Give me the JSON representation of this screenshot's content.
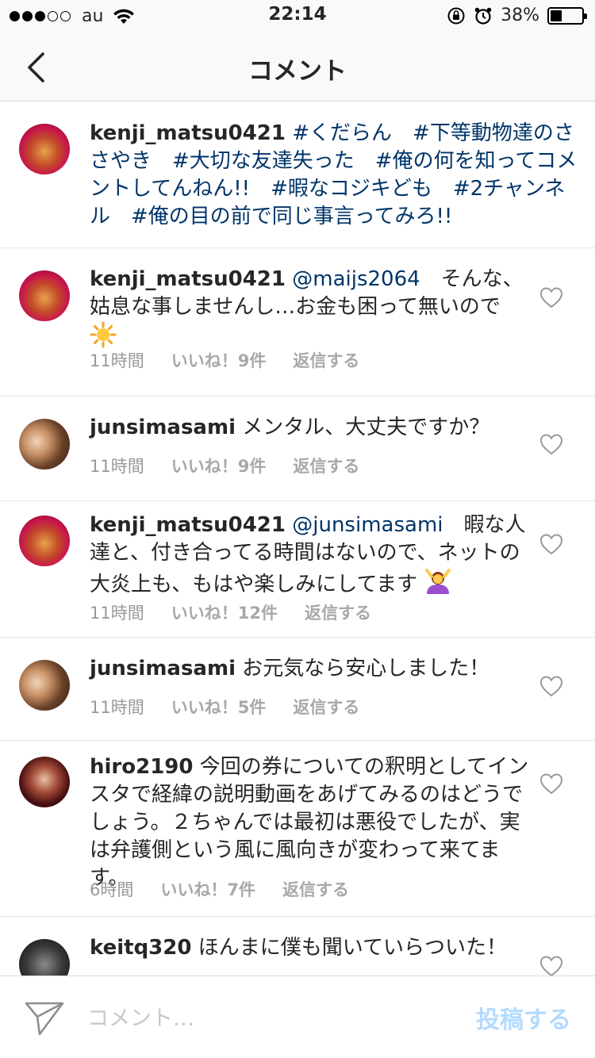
{
  "status_bar": {
    "signal_dots": [
      true,
      true,
      true,
      false,
      false
    ],
    "carrier": "au",
    "time": "22:14",
    "battery": "38%",
    "battery_level": 0.38,
    "icons": [
      "wifi-icon",
      "orientation-lock-icon",
      "alarm-icon",
      "battery-icon"
    ]
  },
  "nav": {
    "title": "コメント",
    "back_icon": "chevron-left-icon"
  },
  "comments": [
    {
      "username": "kenji_matsu0421",
      "text": "#くだらん　#下等動物達のささやき　#大切な友達失った　#俺の何を知ってコメントしてんねん!!　#暇なコジキども　#2チャンネル　#俺の目の前で同じ事言ってみろ!!",
      "is_caption": true
    },
    {
      "username": "kenji_matsu0421",
      "mention": "@maijs2064",
      "text": "　そんな、姑息な事しませんし…お金も困って無いので",
      "emoji": "sun-emoji",
      "time": "11時間",
      "likes": "いいね！9件",
      "reply": "返信する"
    },
    {
      "username": "junsimasami",
      "text": "メンタル、大丈夫ですか？",
      "time": "11時間",
      "likes": "いいね！9件",
      "reply": "返信する"
    },
    {
      "username": "kenji_matsu0421",
      "mention": "@junsimasami",
      "text": "　暇な人達と、付き合ってる時間はないので、ネットの大炎上も、もはや楽しみにしてます",
      "emoji": "woman-gesturing-ok-emoji",
      "time": "11時間",
      "likes": "いいね！12件",
      "reply": "返信する"
    },
    {
      "username": "junsimasami",
      "text": "お元気なら安心しました！",
      "time": "11時間",
      "likes": "いいね！5件",
      "reply": "返信する"
    },
    {
      "username": "hiro2190",
      "text": "今回の券についての釈明としてインスタで経緯の説明動画をあげてみるのはどうでしょう。２ちゃんでは最初は悪役でしたが、実は弁護側という風に風向きが変わって来てます。",
      "time": "6時間",
      "likes": "いいね！7件",
      "reply": "返信する"
    },
    {
      "username": "keitq320",
      "text": "ほんまに僕も聞いていらついた！"
    }
  ],
  "input_bar": {
    "placeholder": "コメント…",
    "post_label": "投稿する",
    "send_icon": "paper-plane-icon"
  },
  "colors": {
    "hashtag": "#003569",
    "meta": "#999999",
    "post_disabled": "#b3dbff",
    "divider": "#e6e6e6"
  }
}
